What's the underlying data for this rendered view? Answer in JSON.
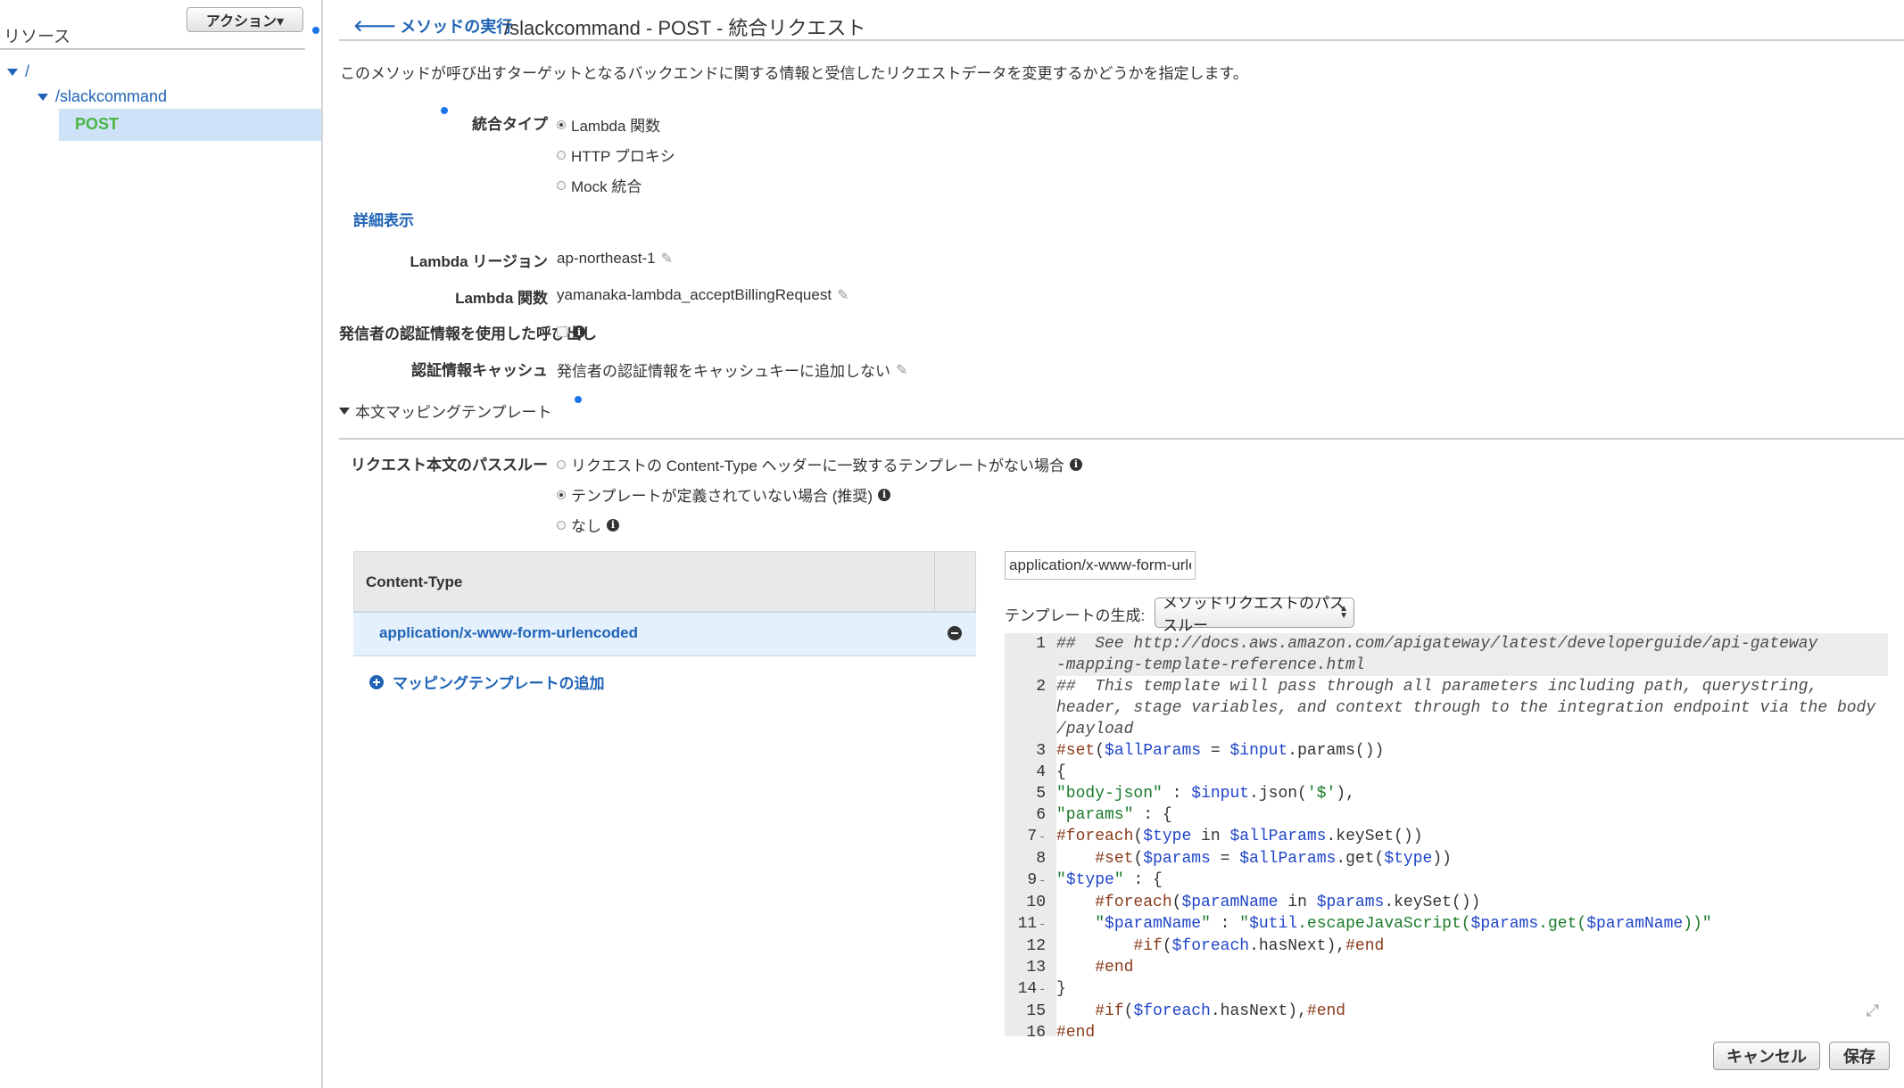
{
  "left": {
    "title": "リソース",
    "action_button": "アクション▾",
    "tree": [
      {
        "label": "/"
      },
      {
        "label": "/slackcommand"
      },
      {
        "label": "POST"
      }
    ]
  },
  "header": {
    "back_link": "メソッドの実行",
    "title": "/slackcommand - POST - 統合リクエスト"
  },
  "description": "このメソッドが呼び出すターゲットとなるバックエンドに関する情報と受信したリクエストデータを変更するかどうかを指定します。",
  "integration": {
    "label": "統合タイプ",
    "options": [
      "Lambda 関数",
      "HTTP プロキシ",
      "Mock 統合"
    ],
    "selected": "Lambda 関数"
  },
  "details_link": "詳細表示",
  "lambda_region": {
    "label": "Lambda リージョン",
    "value": "ap-northeast-1"
  },
  "lambda_function": {
    "label": "Lambda 関数",
    "value": "yamanaka-lambda_acceptBillingRequest"
  },
  "caller_credentials": {
    "label": "発信者の認証情報を使用した呼び出し"
  },
  "credentials_cache": {
    "label": "認証情報キャッシュ",
    "value": "発信者の認証情報をキャッシュキーに追加しない"
  },
  "mapping_section": {
    "label": "本文マッピングテンプレート"
  },
  "passthrough": {
    "label": "リクエスト本文のパススルー",
    "options": [
      "リクエストの Content-Type ヘッダーに一致するテンプレートがない場合",
      "テンプレートが定義されていない場合 (推奨)",
      "なし"
    ],
    "selected": "テンプレートが定義されていない場合 (推奨)"
  },
  "content_type_table": {
    "header": "Content-Type",
    "rows": [
      "application/x-www-form-urlencoded"
    ],
    "add_label": "マッピングテンプレートの追加"
  },
  "editor": {
    "content_type_value": "application/x-www-form-urlencoded",
    "gen_label": "テンプレートの生成:",
    "gen_select": "メソッドリクエストのパススルー"
  },
  "buttons": {
    "cancel": "キャンセル",
    "save": "保存"
  }
}
